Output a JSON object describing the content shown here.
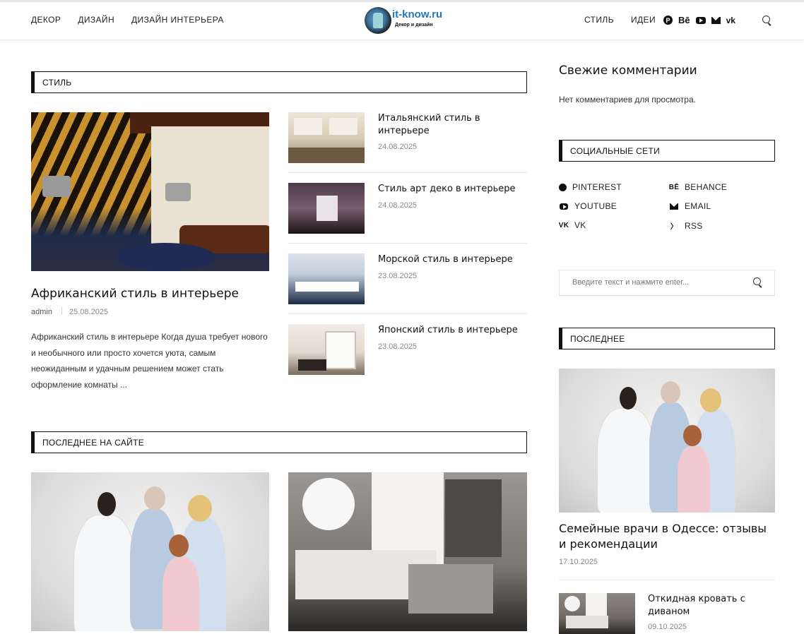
{
  "header": {
    "nav_left": [
      "ДЕКОР",
      "ДИЗАЙН",
      "ДИЗАЙН ИНТЕРЬЕРА"
    ],
    "nav_right": [
      "СТИЛЬ",
      "ИДЕИ"
    ],
    "logo_text": "it-know.ru",
    "logo_sub": "Декор и дизайн",
    "icons": [
      "pinterest-icon",
      "behance-icon",
      "youtube-icon",
      "email-icon",
      "vk-icon",
      "menu-icon",
      "search-icon"
    ]
  },
  "style_section": {
    "heading": "СТИЛЬ",
    "featured": {
      "title": "Африканский стиль в интерьере",
      "author": "admin",
      "date": "25.08.2025",
      "excerpt": "Африканский стиль в интерьере Когда душа требует нового и необычного или просто хочется уюта, самым неожиданным и удачным решением может стать оформление комнаты ..."
    },
    "list": [
      {
        "title_l1": "Итальянский стиль в",
        "title_l2": "интерьере",
        "date": "24.08.2025"
      },
      {
        "title_l1": "Стиль арт деко в интерьере",
        "title_l2": "",
        "date": "24.08.2025"
      },
      {
        "title_l1": "Морской стиль в интерьере",
        "title_l2": "",
        "date": "23.08.2025"
      },
      {
        "title_l1": "Японский стиль в интерьере",
        "title_l2": "",
        "date": "23.08.2025"
      }
    ]
  },
  "latest_section": {
    "heading": "ПОСЛЕДНЕЕ НА САЙТЕ"
  },
  "sidebar": {
    "comments_title": "Свежие комментарии",
    "comments_empty": "Нет комментариев для просмотра.",
    "social_heading": "СОЦИАЛЬНЫЕ СЕТИ",
    "social": [
      {
        "label": "PINTEREST",
        "icon": "pinterest-icon"
      },
      {
        "label": "BEHANCE",
        "icon": "behance-icon"
      },
      {
        "label": "YOUTUBE",
        "icon": "youtube-icon"
      },
      {
        "label": "EMAIL",
        "icon": "email-icon"
      },
      {
        "label": "VK",
        "icon": "vk-icon"
      },
      {
        "label": "RSS",
        "icon": "rss-icon"
      }
    ],
    "search_placeholder": "Введите текст и нажмите enter...",
    "recent_heading": "ПОСЛЕДНЕЕ",
    "recent_big": {
      "title_l1": "Семейные врачи в Одессе: отзывы",
      "title_l2": "и рекомендации",
      "date": "17.10.2025"
    },
    "recent_small": {
      "title_l1": "Откидная кровать с",
      "title_l2": "диваном",
      "date": "09.10.2025"
    }
  }
}
